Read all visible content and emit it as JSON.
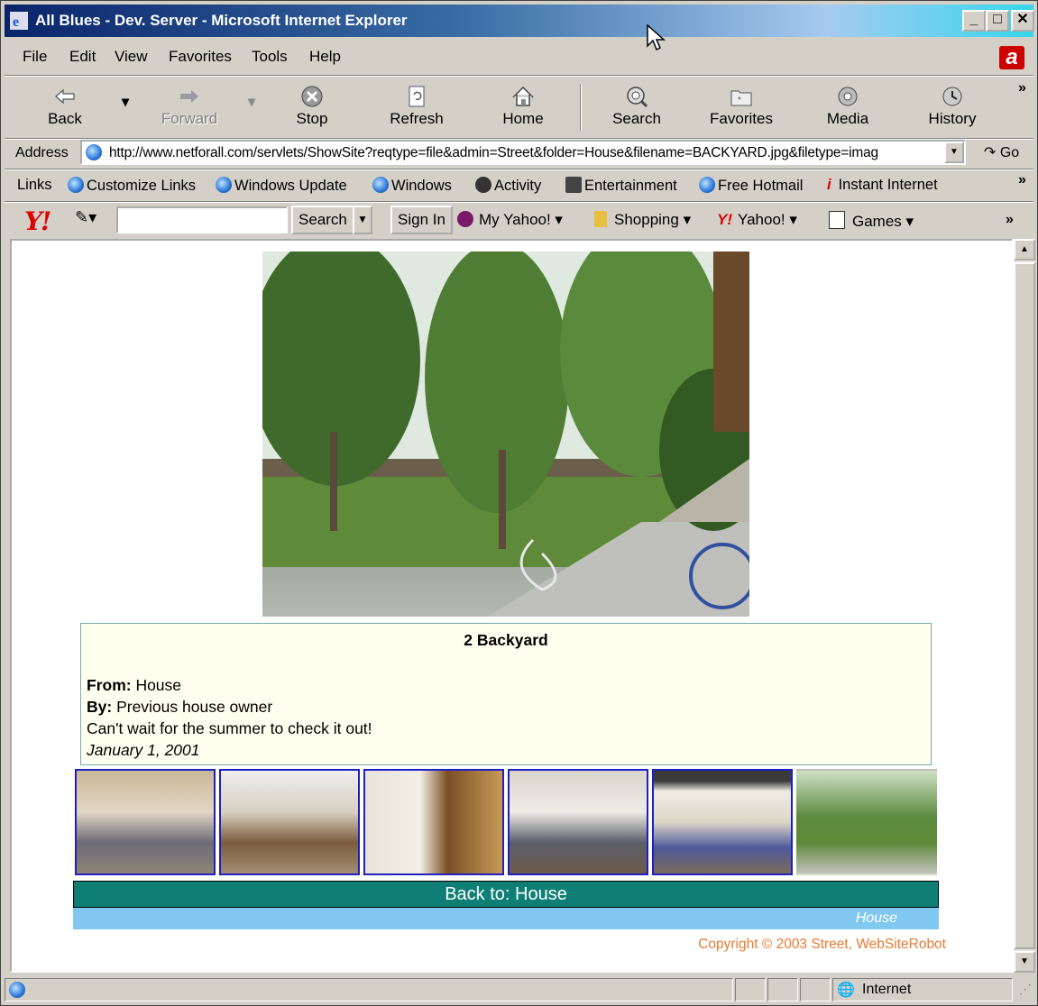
{
  "window": {
    "title": "All Blues - Dev. Server - Microsoft Internet Explorer",
    "minimize": "_",
    "maximize": "□",
    "close": "✕"
  },
  "menu": [
    "File",
    "Edit",
    "View",
    "Favorites",
    "Tools",
    "Help"
  ],
  "toolbar": {
    "back": "Back",
    "forward": "Forward",
    "stop": "Stop",
    "refresh": "Refresh",
    "home": "Home",
    "search": "Search",
    "favorites": "Favorites",
    "media": "Media",
    "history": "History"
  },
  "address": {
    "label": "Address",
    "url": "http://www.netforall.com/servlets/ShowSite?reqtype=file&admin=Street&folder=House&filename=BACKYARD.jpg&filetype=imag",
    "go": "Go"
  },
  "links": {
    "label": "Links",
    "items": [
      "Customize Links",
      "Windows Update",
      "Windows",
      "Activity",
      "Entertainment",
      "Free Hotmail",
      "Instant Internet"
    ]
  },
  "yahoo": {
    "search_value": "",
    "search_btn": "Search",
    "signin": "Sign In",
    "my_yahoo": "My Yahoo!",
    "shopping": "Shopping",
    "yahoo": "Yahoo!",
    "games": "Games"
  },
  "page": {
    "caption_title": "2  Backyard",
    "from_label": "From:",
    "from_value": " House",
    "by_label": "By:",
    "by_value": " Previous house owner",
    "description": "Can't wait for the summer to check it out!",
    "date": "January 1, 2001",
    "back_link": "Back to: House",
    "sub_link": "House",
    "copyright": "Copyright © 2003 Street, WebSiteRobot"
  },
  "status": {
    "zone": "Internet"
  }
}
